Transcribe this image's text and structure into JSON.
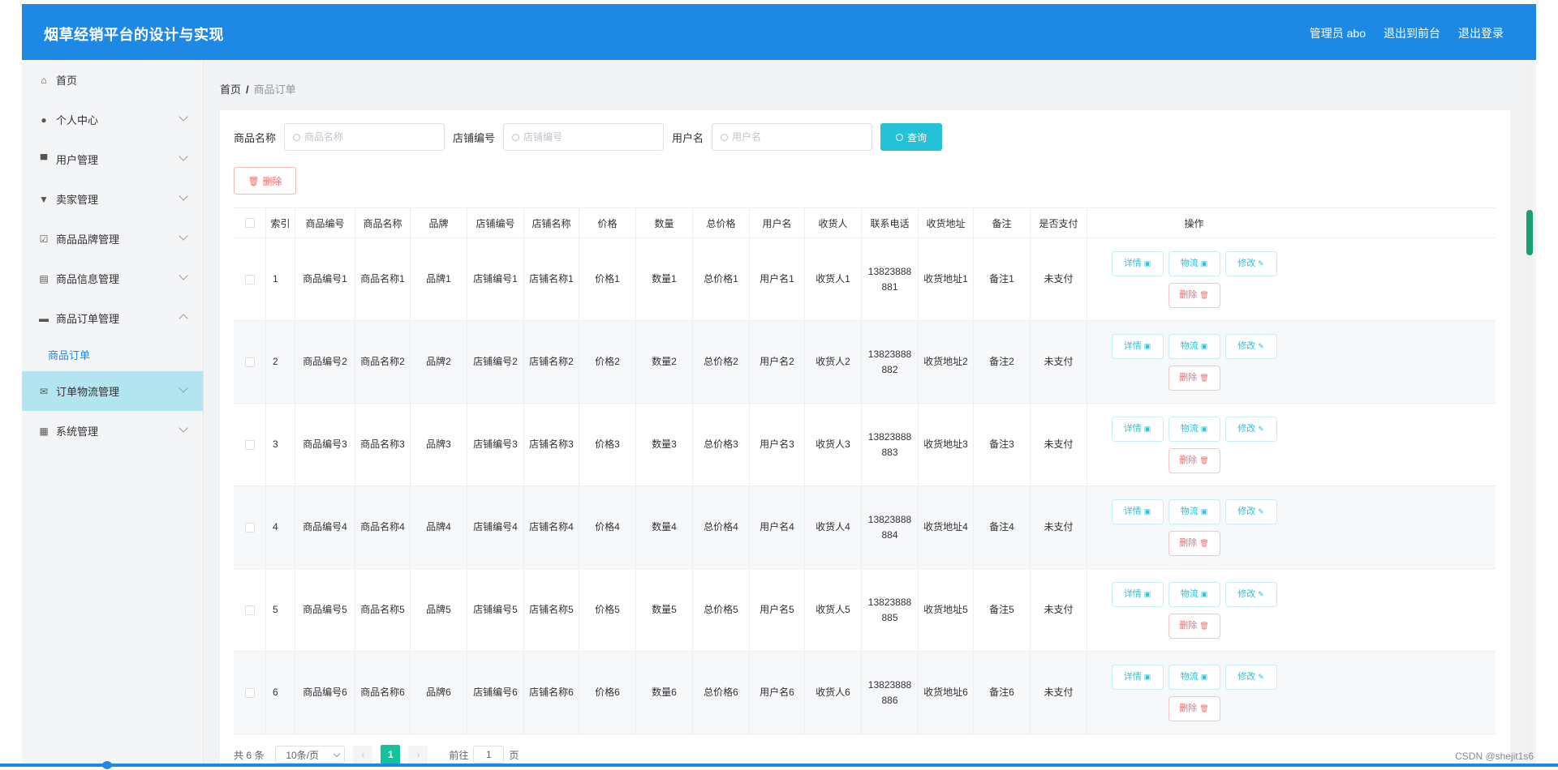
{
  "app": {
    "title": "烟草经销平台的设计与实现",
    "user_label": "管理员 abo",
    "back_to_front": "退出到前台",
    "logout": "退出登录"
  },
  "sidebar": {
    "items": [
      {
        "label": "首页",
        "icon": "home-icon",
        "has_children": false
      },
      {
        "label": "个人中心",
        "icon": "user-icon",
        "has_children": true
      },
      {
        "label": "用户管理",
        "icon": "monitor-icon",
        "has_children": true
      },
      {
        "label": "卖家管理",
        "icon": "stamp-icon",
        "has_children": true
      },
      {
        "label": "商品品牌管理",
        "icon": "checkbox-icon",
        "has_children": true
      },
      {
        "label": "商品信息管理",
        "icon": "clipboard-icon",
        "has_children": true
      },
      {
        "label": "商品订单管理",
        "icon": "ticket-icon",
        "has_children": true,
        "expanded": true
      },
      {
        "label": "订单物流管理",
        "icon": "mail-icon",
        "has_children": true,
        "active": true
      },
      {
        "label": "系统管理",
        "icon": "grid-icon",
        "has_children": true
      }
    ],
    "submenu": {
      "label": "商品订单"
    }
  },
  "breadcrumb": {
    "home": "首页",
    "separator": "/",
    "current": "商品订单"
  },
  "search": {
    "fields": [
      {
        "label": "商品名称",
        "placeholder": "商品名称"
      },
      {
        "label": "店铺编号",
        "placeholder": "店铺编号"
      },
      {
        "label": "用户名",
        "placeholder": "用户名"
      }
    ],
    "query_label": "查询"
  },
  "toolbar": {
    "delete_label": "删除"
  },
  "table": {
    "columns": [
      "索引",
      "商品编号",
      "商品名称",
      "品牌",
      "店铺编号",
      "店铺名称",
      "价格",
      "数量",
      "总价格",
      "用户名",
      "收货人",
      "联系电话",
      "收货地址",
      "备注",
      "是否支付",
      "操作"
    ],
    "rows": [
      {
        "index": "1",
        "code": "商品编号1",
        "name": "商品名称1",
        "brand": "品牌1",
        "shop_code": "店铺编号1",
        "shop_name": "店铺名称1",
        "price": "价格1",
        "qty": "数量1",
        "total": "总价格1",
        "username": "用户名1",
        "receiver": "收货人1",
        "phone": "13823888881",
        "address": "收货地址1",
        "note": "备注1",
        "paid": "未支付"
      },
      {
        "index": "2",
        "code": "商品编号2",
        "name": "商品名称2",
        "brand": "品牌2",
        "shop_code": "店铺编号2",
        "shop_name": "店铺名称2",
        "price": "价格2",
        "qty": "数量2",
        "total": "总价格2",
        "username": "用户名2",
        "receiver": "收货人2",
        "phone": "13823888882",
        "address": "收货地址2",
        "note": "备注2",
        "paid": "未支付"
      },
      {
        "index": "3",
        "code": "商品编号3",
        "name": "商品名称3",
        "brand": "品牌3",
        "shop_code": "店铺编号3",
        "shop_name": "店铺名称3",
        "price": "价格3",
        "qty": "数量3",
        "total": "总价格3",
        "username": "用户名3",
        "receiver": "收货人3",
        "phone": "13823888883",
        "address": "收货地址3",
        "note": "备注3",
        "paid": "未支付"
      },
      {
        "index": "4",
        "code": "商品编号4",
        "name": "商品名称4",
        "brand": "品牌4",
        "shop_code": "店铺编号4",
        "shop_name": "店铺名称4",
        "price": "价格4",
        "qty": "数量4",
        "total": "总价格4",
        "username": "用户名4",
        "receiver": "收货人4",
        "phone": "13823888884",
        "address": "收货地址4",
        "note": "备注4",
        "paid": "未支付"
      },
      {
        "index": "5",
        "code": "商品编号5",
        "name": "商品名称5",
        "brand": "品牌5",
        "shop_code": "店铺编号5",
        "shop_name": "店铺名称5",
        "price": "价格5",
        "qty": "数量5",
        "total": "总价格5",
        "username": "用户名5",
        "receiver": "收货人5",
        "phone": "13823888885",
        "address": "收货地址5",
        "note": "备注5",
        "paid": "未支付"
      },
      {
        "index": "6",
        "code": "商品编号6",
        "name": "商品名称6",
        "brand": "品牌6",
        "shop_code": "店铺编号6",
        "shop_name": "店铺名称6",
        "price": "价格6",
        "qty": "数量6",
        "total": "总价格6",
        "username": "用户名6",
        "receiver": "收货人6",
        "phone": "13823888886",
        "address": "收货地址6",
        "note": "备注6",
        "paid": "未支付"
      }
    ],
    "row_actions": {
      "detail": "详情",
      "logistics": "物流",
      "edit": "修改",
      "delete": "删除"
    }
  },
  "pagination": {
    "total": "共 6 条",
    "page_size": "10条/页",
    "current_page": "1",
    "goto_label": "前往",
    "goto_value": "1",
    "page_unit": "页"
  },
  "watermark": "CSDN @shejit1s6",
  "colors": {
    "header": "#1e88e5",
    "accent": "#26c1d6",
    "danger": "#f56c6c",
    "active_menu": "#b2e5f0",
    "page_active": "#13c39b"
  }
}
